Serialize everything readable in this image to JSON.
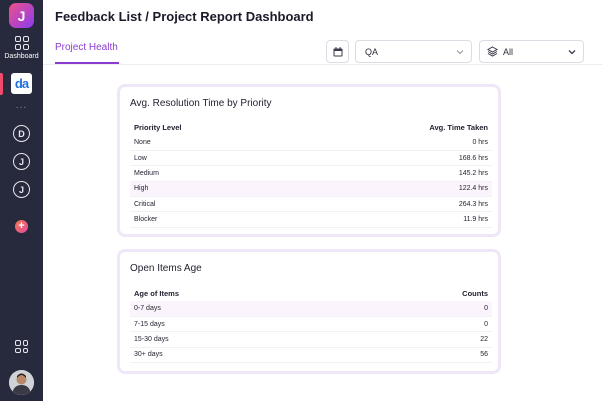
{
  "sidebar": {
    "logo_letter": "J",
    "dashboard_label": "Dashboard",
    "project_badge": "da",
    "more": "...",
    "projects": [
      "D",
      "J",
      "J"
    ],
    "add_symbol": "+"
  },
  "header": {
    "title": "Feedback List / Project Report Dashboard",
    "tab": "Project Health",
    "filter_qa": "QA",
    "filter_all": "All"
  },
  "resolution_card": {
    "title": "Avg. Resolution Time by Priority",
    "col_priority": "Priority Level",
    "col_time": "Avg. Time Taken",
    "rows": [
      {
        "priority": "None",
        "time": "0 hrs"
      },
      {
        "priority": "Low",
        "time": "168.6 hrs"
      },
      {
        "priority": "Medium",
        "time": "145.2 hrs"
      },
      {
        "priority": "High",
        "time": "122.4 hrs"
      },
      {
        "priority": "Critical",
        "time": "264.3 hrs"
      },
      {
        "priority": "Blocker",
        "time": "11.9 hrs"
      }
    ]
  },
  "age_card": {
    "title": "Open Items Age",
    "col_age": "Age of Items",
    "col_counts": "Counts",
    "rows": [
      {
        "age": "0-7 days",
        "count": "0"
      },
      {
        "age": "7-15 days",
        "count": "0"
      },
      {
        "age": "15-30 days",
        "count": "22"
      },
      {
        "age": "30+ days",
        "count": "56"
      }
    ]
  },
  "colors": {
    "sidebar_bg": "#27293d",
    "accent": "#8a3cd0",
    "card_border": "#efe6f7"
  }
}
